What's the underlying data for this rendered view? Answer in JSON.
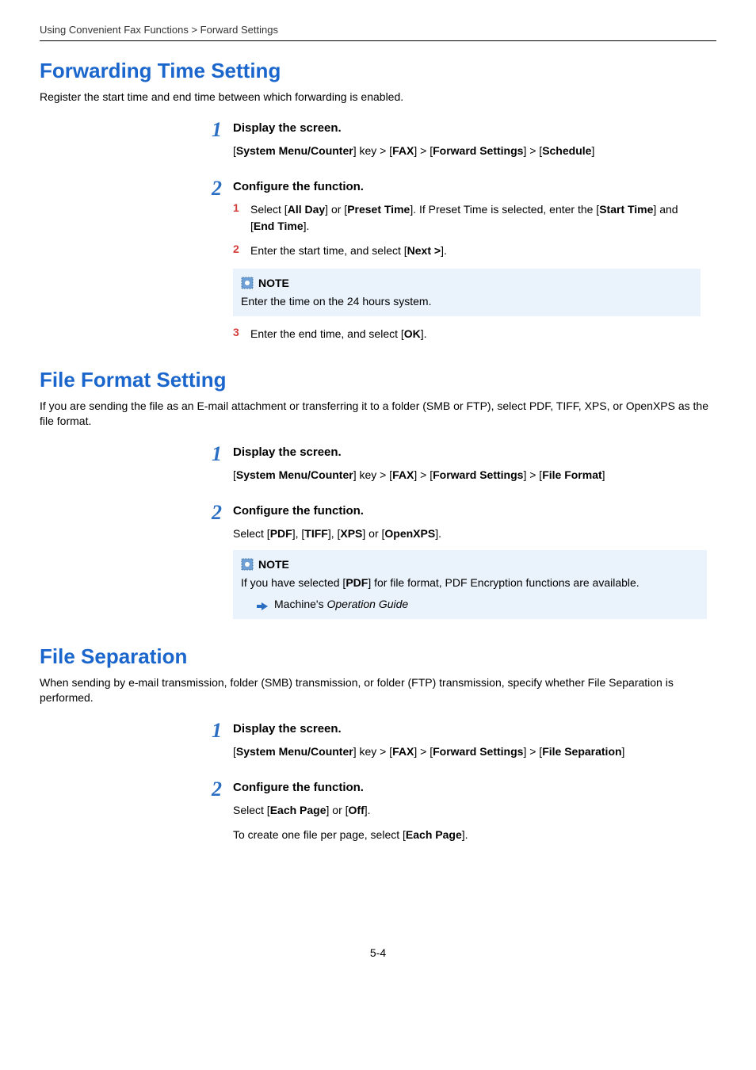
{
  "breadcrumb": "Using Convenient Fax Functions > Forward Settings",
  "section1": {
    "heading": "Forwarding Time Setting",
    "intro": "Register the start time and end time between which forwarding is enabled.",
    "step1": {
      "num": "1",
      "title": "Display the screen.",
      "path_pre": "[",
      "path_k1": "System Menu/Counter",
      "path_mid1": "] key > [",
      "path_k2": "FAX",
      "path_mid2": "] > [",
      "path_k3": "Forward Settings",
      "path_mid3": "] > [",
      "path_k4": "Schedule",
      "path_post": "]"
    },
    "step2": {
      "num": "2",
      "title": "Configure the function.",
      "sub1": {
        "num": "1",
        "t1": "Select [",
        "b1": "All Day",
        "t2": "] or [",
        "b2": "Preset Time",
        "t3": "]. If Preset Time is selected, enter the [",
        "b3": "Start Time",
        "t4": "] and [",
        "b4": "End Time",
        "t5": "]."
      },
      "sub2": {
        "num": "2",
        "t1": "Enter the start time, and select [",
        "b1": "Next >",
        "t2": "]."
      },
      "note": {
        "label": "NOTE",
        "body": "Enter the time on the 24 hours system."
      },
      "sub3": {
        "num": "3",
        "t1": "Enter the end time, and select [",
        "b1": "OK",
        "t2": "]."
      }
    }
  },
  "section2": {
    "heading": "File Format Setting",
    "intro": "If you are sending the file as an E-mail attachment or transferring it to a folder (SMB or FTP), select PDF, TIFF, XPS, or OpenXPS as the file format.",
    "step1": {
      "num": "1",
      "title": "Display the screen.",
      "path_pre": "[",
      "path_k1": "System Menu/Counter",
      "path_mid1": "] key > [",
      "path_k2": "FAX",
      "path_mid2": "] > [",
      "path_k3": "Forward Settings",
      "path_mid3": "] > [",
      "path_k4": "File Format",
      "path_post": "]"
    },
    "step2": {
      "num": "2",
      "title": "Configure the function.",
      "t1": "Select [",
      "b1": "PDF",
      "t2": "], [",
      "b2": "TIFF",
      "t3": "], [",
      "b3": "XPS",
      "t4": "] or [",
      "b4": "OpenXPS",
      "t5": "].",
      "note": {
        "label": "NOTE",
        "body_t1": "If you have selected [",
        "body_b1": "PDF",
        "body_t2": "] for file format, PDF Encryption functions are available.",
        "ref_pre": "Machine's ",
        "ref_italic": "Operation Guide"
      }
    }
  },
  "section3": {
    "heading": "File Separation",
    "intro": "When sending by e-mail transmission, folder (SMB) transmission, or folder (FTP) transmission, specify whether File Separation is performed.",
    "step1": {
      "num": "1",
      "title": "Display the screen.",
      "path_pre": "[",
      "path_k1": "System Menu/Counter",
      "path_mid1": "] key > [",
      "path_k2": "FAX",
      "path_mid2": "] > [",
      "path_k3": "Forward Settings",
      "path_mid3": "] > [",
      "path_k4": "File Separation",
      "path_post": "]"
    },
    "step2": {
      "num": "2",
      "title": "Configure the function.",
      "line1_t1": "Select [",
      "line1_b1": "Each Page",
      "line1_t2": "] or [",
      "line1_b2": "Off",
      "line1_t3": "].",
      "line2_t1": "To create one file per page, select [",
      "line2_b1": "Each Page",
      "line2_t2": "]."
    }
  },
  "page_number": "5-4"
}
